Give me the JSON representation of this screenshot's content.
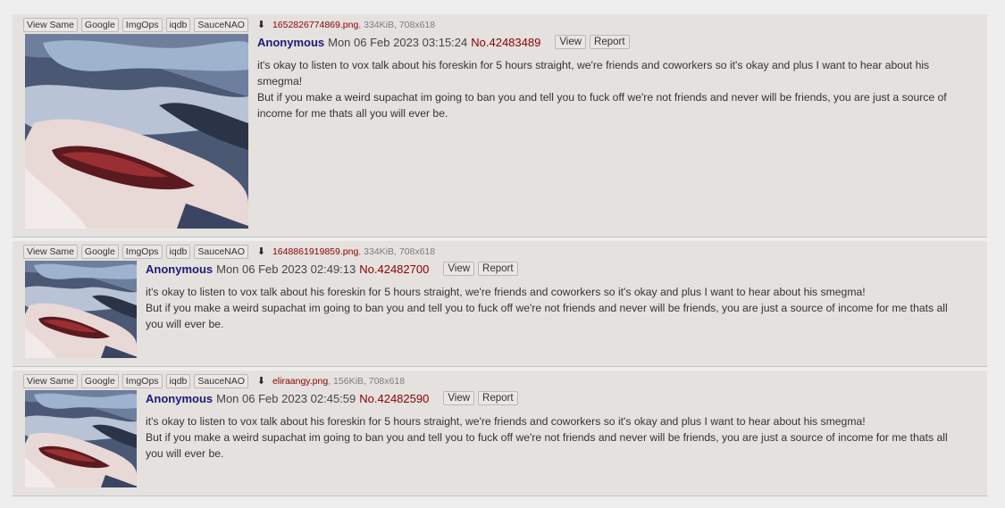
{
  "tools": {
    "view_same": "View Same",
    "google": "Google",
    "imgops": "ImgOps",
    "iqdb": "iqdb",
    "saucenao": "SauceNAO",
    "view": "View",
    "report": "Report"
  },
  "posts": [
    {
      "filename": "1652826774869.png",
      "filemeta": ", 334KiB, 708x618",
      "name": "Anonymous",
      "date": "Mon 06 Feb 2023 03:15:24",
      "number": "No.42483489",
      "line1": "it's okay to listen to vox talk about his foreskin for 5 hours straight, we're friends and coworkers so it's okay and plus I want to hear about his smegma!",
      "line2": "But if you make a weird supachat im going to ban you and tell you to fuck off we're not friends and never will be friends, you are just a source of income for me thats all you will ever be."
    },
    {
      "filename": "1648861919859.png",
      "filemeta": ", 334KiB, 708x618",
      "name": "Anonymous",
      "date": "Mon 06 Feb 2023 02:49:13",
      "number": "No.42482700",
      "line1": "it's okay to listen to vox talk about his foreskin for 5 hours straight, we're friends and coworkers so it's okay and plus I want to hear about his smegma!",
      "line2": "But if you make a weird supachat im going to ban you and tell you to fuck off we're not friends and never will be friends, you are just a source of income for me thats all you will ever be."
    },
    {
      "filename": "eliraangy.png",
      "filemeta": ", 156KiB, 708x618",
      "name": "Anonymous",
      "date": "Mon 06 Feb 2023 02:45:59",
      "number": "No.42482590",
      "line1": "it's okay to listen to vox talk about his foreskin for 5 hours straight, we're friends and coworkers so it's okay and plus I want to hear about his smegma!",
      "line2": "But if you make a weird supachat im going to ban you and tell you to fuck off we're not friends and never will be friends, you are just a source of income for me thats all you will ever be."
    }
  ],
  "icons": {
    "download": "download-icon"
  }
}
